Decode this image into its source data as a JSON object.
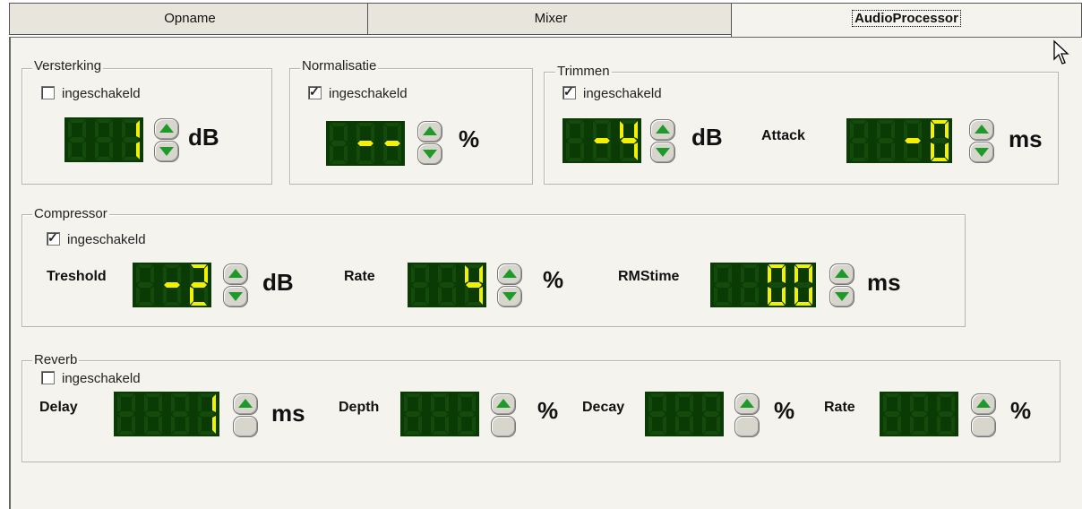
{
  "tabs": [
    {
      "label": "Opname",
      "active": false
    },
    {
      "label": "Mixer",
      "active": false
    },
    {
      "label": "AudioProcessor",
      "active": true
    }
  ],
  "groups": {
    "versterking": {
      "title": "Versterking",
      "checkbox": "ingeschakeld",
      "checked": false,
      "unit": "dB",
      "display": "  1"
    },
    "normalisatie": {
      "title": "Normalisatie",
      "checkbox": "ingeschakeld",
      "checked": true,
      "unit": "%",
      "display": " --"
    },
    "trimmen": {
      "title": "Trimmen",
      "checkbox": "ingeschakeld",
      "checked": true,
      "unit": "dB",
      "display": " -4",
      "attack_label": "Attack",
      "attack_unit": "ms",
      "attack_display": " -0"
    },
    "compressor": {
      "title": "Compressor",
      "checkbox": "ingeschakeld",
      "checked": true,
      "treshold_label": "Treshold",
      "treshold_unit": "dB",
      "treshold_display": " -2",
      "rate_label": "Rate",
      "rate_unit": "%",
      "rate_display": " 4",
      "rmstime_label": "RMStime",
      "rmstime_unit": "ms",
      "rmstime_display": " 00"
    },
    "reverb": {
      "title": "Reverb",
      "checkbox": "ingeschakeld",
      "checked": false,
      "delay_label": "Delay",
      "delay_unit": "ms",
      "delay_display": "   1",
      "depth_label": "Depth",
      "depth_unit": "%",
      "decay_label": "Decay",
      "decay_unit": "%",
      "rate_label": "Rate",
      "rate_unit": "%"
    }
  },
  "colors": {
    "lcd_bg": "#0b3b05",
    "segment_on": "#f3f000",
    "segment_off": "#144a0c",
    "arrow": "#1d9a2a"
  }
}
